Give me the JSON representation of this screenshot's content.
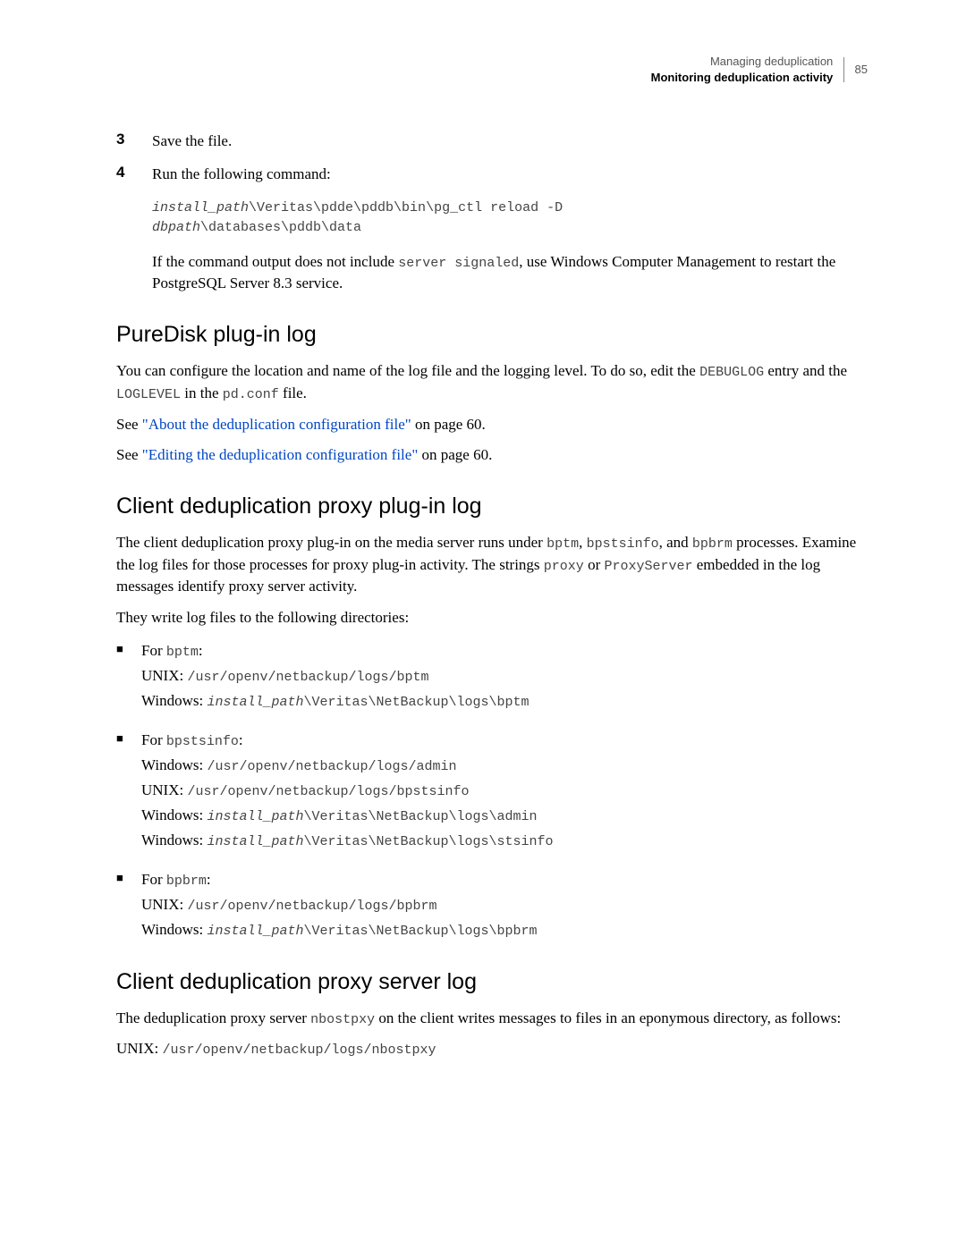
{
  "header": {
    "category": "Managing deduplication",
    "section": "Monitoring deduplication activity",
    "page": "85"
  },
  "steps": [
    {
      "num": "3",
      "text": "Save the file."
    },
    {
      "num": "4",
      "text": "Run the following command:"
    }
  ],
  "step4": {
    "code_line1_part1": "install_path",
    "code_line1_part2": "\\Veritas\\pdde\\pddb\\bin\\pg_ctl reload -D",
    "code_line2_part1": "dbpath",
    "code_line2_part2": "\\databases\\pddb\\data",
    "followup_pre": "If the command output does not include ",
    "followup_code": "server signaled",
    "followup_post": ", use Windows Computer Management to restart the PostgreSQL Server 8.3 service."
  },
  "sec1": {
    "title": "PureDisk plug-in log",
    "p1_pre": "You can configure the location and name of the log file and the logging level. To do so, edit the ",
    "p1_c1": "DEBUGLOG",
    "p1_mid1": " entry and the ",
    "p1_c2": "LOGLEVEL",
    "p1_mid2": " in the ",
    "p1_c3": "pd.conf",
    "p1_post": " file.",
    "see1_pre": "See ",
    "see1_link": "\"About the deduplication configuration file\"",
    "see1_post": " on page 60.",
    "see2_pre": "See ",
    "see2_link": "\"Editing the deduplication configuration file\"",
    "see2_post": " on page 60."
  },
  "sec2": {
    "title": "Client deduplication proxy plug-in log",
    "p1_pre": "The client deduplication proxy plug-in on the media server runs under ",
    "p1_c1": "bptm",
    "p1_mid1": ", ",
    "p1_c2": "bpstsinfo",
    "p1_mid2": ", and ",
    "p1_c3": "bpbrm",
    "p1_mid3": " processes. Examine the log files for those processes for proxy plug-in activity. The strings ",
    "p1_c4": "proxy",
    "p1_mid4": " or ",
    "p1_c5": "ProxyServer",
    "p1_post": " embedded in the log messages identify proxy server activity.",
    "p2": "They write log files to the following directories:",
    "bullets": [
      {
        "label_pre": "For ",
        "label_code": "bptm",
        "label_post": ":",
        "lines": [
          {
            "prefix": "UNIX: ",
            "code": "/usr/openv/netbackup/logs/bptm"
          },
          {
            "prefix": "Windows: ",
            "code_italic": "install_path",
            "code": "\\Veritas\\NetBackup\\logs\\bptm"
          }
        ]
      },
      {
        "label_pre": "For ",
        "label_code": "bpstsinfo",
        "label_post": ":",
        "lines": [
          {
            "prefix": "Windows: ",
            "code": "/usr/openv/netbackup/logs/admin"
          },
          {
            "prefix": "UNIX: ",
            "code": "/usr/openv/netbackup/logs/bpstsinfo"
          },
          {
            "prefix": "Windows: ",
            "code_italic": "install_path",
            "code": "\\Veritas\\NetBackup\\logs\\admin"
          },
          {
            "prefix": "Windows: ",
            "code_italic": "install_path",
            "code": "\\Veritas\\NetBackup\\logs\\stsinfo"
          }
        ]
      },
      {
        "label_pre": "For ",
        "label_code": "bpbrm",
        "label_post": ":",
        "lines": [
          {
            "prefix": "UNIX: ",
            "code": "/usr/openv/netbackup/logs/bpbrm"
          },
          {
            "prefix": "Windows: ",
            "code_italic": "install_path",
            "code": "\\Veritas\\NetBackup\\logs\\bpbrm"
          }
        ]
      }
    ]
  },
  "sec3": {
    "title": "Client deduplication proxy server log",
    "p1_pre": "The deduplication proxy server ",
    "p1_code": "nbostpxy",
    "p1_post": " on the client writes messages to files in an eponymous directory, as follows:",
    "line_prefix": "UNIX: ",
    "line_code": "/usr/openv/netbackup/logs/nbostpxy"
  }
}
